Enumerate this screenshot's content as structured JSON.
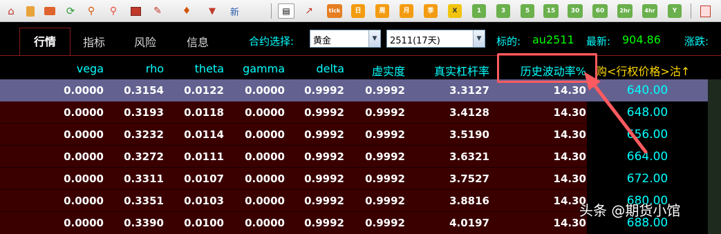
{
  "toolbar": {
    "icons": [
      "home-icon",
      "notebook-icon",
      "chart-icon",
      "refresh-icon",
      "search-icon",
      "search-alt-icon",
      "window-icon",
      "pen-icon",
      "bell-icon",
      "filter-icon"
    ],
    "new_label": "新",
    "tick_label": "tick",
    "periods": [
      "日",
      "周",
      "月",
      "季",
      "X",
      "1",
      "3",
      "5",
      "15",
      "30",
      "60",
      "2hr",
      "4hr",
      "Y"
    ]
  },
  "tabs": [
    "行情",
    "指标",
    "风险",
    "信息"
  ],
  "contract": {
    "label": "合约选择:",
    "commodity": "黄金",
    "expiry": "2511(17天)",
    "symbol_label": "标的:",
    "symbol": "au2511",
    "latest_label": "最新:",
    "latest": "904.86",
    "change_label": "涨跌:"
  },
  "columns": [
    "vega",
    "rho",
    "theta",
    "gamma",
    "delta",
    "虚实度",
    "真实杠杆率",
    "历史波动率%",
    "购<行权价格>沽↑"
  ],
  "rows": [
    {
      "vega": "0.0000",
      "rho": "0.3154",
      "theta": "0.0122",
      "gamma": "0.0000",
      "delta": "0.9992",
      "moneyness": "0.9992",
      "leverage": "3.3127",
      "hv": "14.30",
      "strike": "640.00"
    },
    {
      "vega": "0.0000",
      "rho": "0.3193",
      "theta": "0.0118",
      "gamma": "0.0000",
      "delta": "0.9992",
      "moneyness": "0.9992",
      "leverage": "3.4128",
      "hv": "14.30",
      "strike": "648.00"
    },
    {
      "vega": "0.0000",
      "rho": "0.3232",
      "theta": "0.0114",
      "gamma": "0.0000",
      "delta": "0.9992",
      "moneyness": "0.9992",
      "leverage": "3.5190",
      "hv": "14.30",
      "strike": "656.00"
    },
    {
      "vega": "0.0000",
      "rho": "0.3272",
      "theta": "0.0111",
      "gamma": "0.0000",
      "delta": "0.9992",
      "moneyness": "0.9992",
      "leverage": "3.6321",
      "hv": "14.30",
      "strike": "664.00"
    },
    {
      "vega": "0.0000",
      "rho": "0.3311",
      "theta": "0.0107",
      "gamma": "0.0000",
      "delta": "0.9992",
      "moneyness": "0.9992",
      "leverage": "3.7527",
      "hv": "14.30",
      "strike": "672.00"
    },
    {
      "vega": "0.0000",
      "rho": "0.3351",
      "theta": "0.0103",
      "gamma": "0.0000",
      "delta": "0.9992",
      "moneyness": "0.9992",
      "leverage": "3.8816",
      "hv": "14.30",
      "strike": "680.00"
    },
    {
      "vega": "0.0000",
      "rho": "0.3390",
      "theta": "0.0100",
      "gamma": "0.0000",
      "delta": "0.9992",
      "moneyness": "0.9992",
      "leverage": "4.0197",
      "hv": "14.30",
      "strike": "688.00"
    }
  ],
  "watermark": "头条 @期货小馆",
  "colors": {
    "header_text": "#00ffff",
    "row_bg": "#3a0000",
    "selected_row_bg": "#63618f",
    "highlight": "#ff5a5f",
    "symbol_text": "#00ff00"
  }
}
